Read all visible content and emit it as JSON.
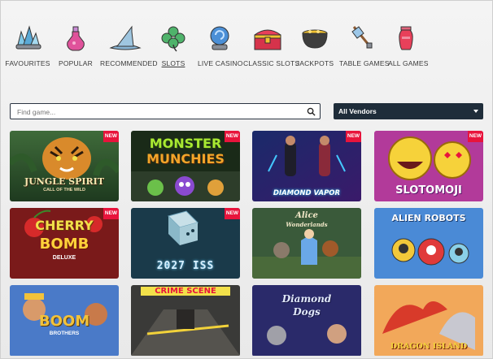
{
  "categories": [
    {
      "label": "FAVOURITES",
      "icon": "crystal-cluster-icon"
    },
    {
      "label": "POPULAR",
      "icon": "potion-bottle-icon"
    },
    {
      "label": "RECOMMENDED",
      "icon": "wizard-hat-icon"
    },
    {
      "label": "SLOTS",
      "icon": "clover-icon",
      "active": true
    },
    {
      "label": "LIVE CASINO",
      "icon": "crystal-ball-icon"
    },
    {
      "label": "CLASSIC SLOTS",
      "icon": "treasure-chest-icon"
    },
    {
      "label": "JACKPOTS",
      "icon": "gold-cauldron-icon"
    },
    {
      "label": "TABLE GAMES",
      "icon": "battle-axe-icon"
    },
    {
      "label": "ALL GAMES",
      "icon": "vase-icon"
    }
  ],
  "search": {
    "placeholder": "Find game..."
  },
  "vendor": {
    "label": "All Vendors"
  },
  "badge_text": "NEW",
  "games": [
    {
      "title": "JUNGLE SPIRIT",
      "subtitle": "CALL OF THE WILD",
      "new": true
    },
    {
      "title": "MONSTER",
      "subtitle": "MUNCHIES",
      "new": true
    },
    {
      "title": "DIAMOND VAPOR",
      "subtitle": "",
      "new": true
    },
    {
      "title": "SLOTOMOJI",
      "subtitle": "",
      "new": true
    },
    {
      "title": "CHERRY",
      "subtitle": "BOMB",
      "extra": "DELUXE",
      "new": true
    },
    {
      "title": "2027 ISS",
      "subtitle": "",
      "new": true
    },
    {
      "title": "Alice",
      "subtitle": "Wonderlands",
      "new": false
    },
    {
      "title": "ALIEN ROBOTS",
      "subtitle": "",
      "new": false
    },
    {
      "title": "BOOM",
      "subtitle": "BROTHERS",
      "new": false
    },
    {
      "title": "CRIME SCENE",
      "subtitle": "",
      "new": false
    },
    {
      "title": "Diamond",
      "subtitle": "Dogs",
      "new": false
    },
    {
      "title": "DRAGON ISLAND",
      "subtitle": "",
      "new": false
    }
  ],
  "colors": {
    "accent": "#e8143c",
    "vendor_bg": "#1f2d3a",
    "search_border": "#2a3441"
  }
}
